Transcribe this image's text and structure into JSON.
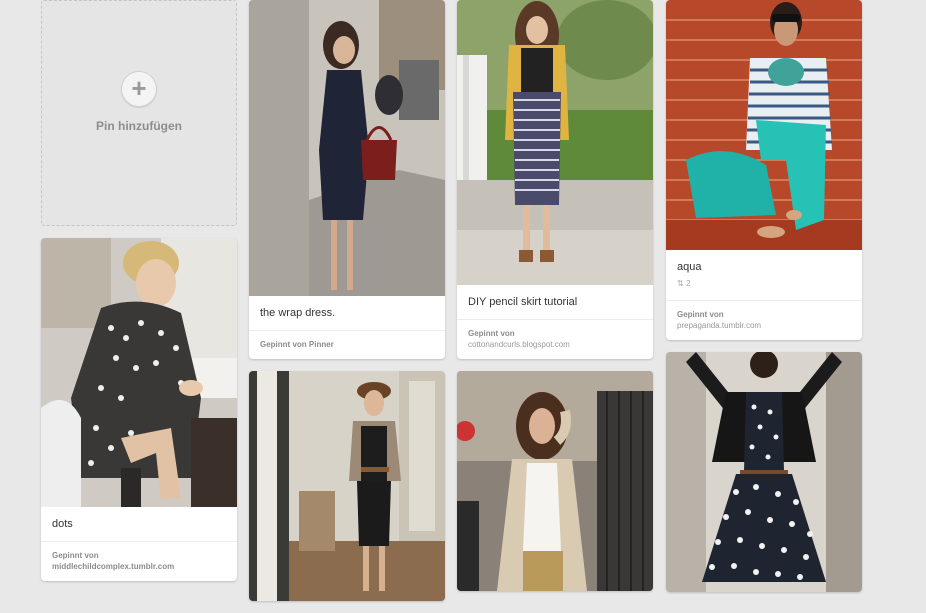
{
  "add_pin": {
    "label": "Pin hinzufügen",
    "icon": "plus-icon"
  },
  "pins": {
    "dots": {
      "description": "dots",
      "pinned_by_label": "Gepinnt von",
      "source": "middlechildcomplex.tumblr.com"
    },
    "wrap": {
      "description": "the wrap dress.",
      "pinned_by_label": "Gepinnt von Pinner"
    },
    "skirt": {
      "description": "DIY pencil skirt tutorial",
      "pinned_by_label": "Gepinnt von",
      "source": "cottonandcurls.blogspot.com"
    },
    "aqua": {
      "description": "aqua",
      "repins": "2",
      "pinned_by_label": "Gepinnt von",
      "source": "prepaganda.tumblr.com"
    }
  },
  "colors": {
    "background": "#e9e8e8",
    "card": "#ffffff",
    "meta_text": "#999999"
  }
}
